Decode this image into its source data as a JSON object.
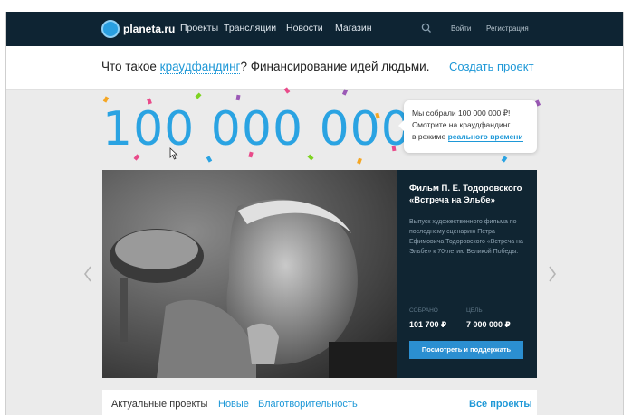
{
  "header": {
    "logo_text": "planeta.ru",
    "nav": [
      "Проекты",
      "Трансляции",
      "Новости",
      "Магазин"
    ],
    "login": "Войти",
    "register": "Регистрация"
  },
  "strip": {
    "text_before": "Что такое ",
    "link": "краудфандинг",
    "text_after": "? Финансирование идей людьми.",
    "create": "Создать проект"
  },
  "counter": {
    "amount": "100 000 000 ₽"
  },
  "bubble": {
    "line1": "Мы собрали 100 000 000 ₽!",
    "line2": "Смотрите на краудфандинг",
    "line3": "в режиме ",
    "link": "реального времени"
  },
  "project": {
    "title": "Фильм П. Е. Тодоровского «Встреча на Эльбе»",
    "description": "Выпуск художественного фильма по последнему сценарию Петра Ефимовича Тодоровского «Встреча на Эльбе» к 70-летию Великой Победы.",
    "collected_label": "СОБРАНО",
    "collected_value": "101 700 ₽",
    "goal_label": "ЦЕЛЬ",
    "goal_value": "7 000 000 ₽",
    "cta": "Посмотреть и поддержать"
  },
  "tabs": {
    "items": [
      "Актуальные проекты",
      "Новые",
      "Благотворительность"
    ],
    "all": "Все проекты"
  },
  "colors": {
    "accent": "#1e98d7",
    "nav_bg": "#0e2433",
    "panel_bg": "#102532",
    "button": "#2b8fd1"
  },
  "icons": {
    "search": "search-icon",
    "prev": "chevron-left-icon",
    "next": "chevron-right-icon"
  }
}
